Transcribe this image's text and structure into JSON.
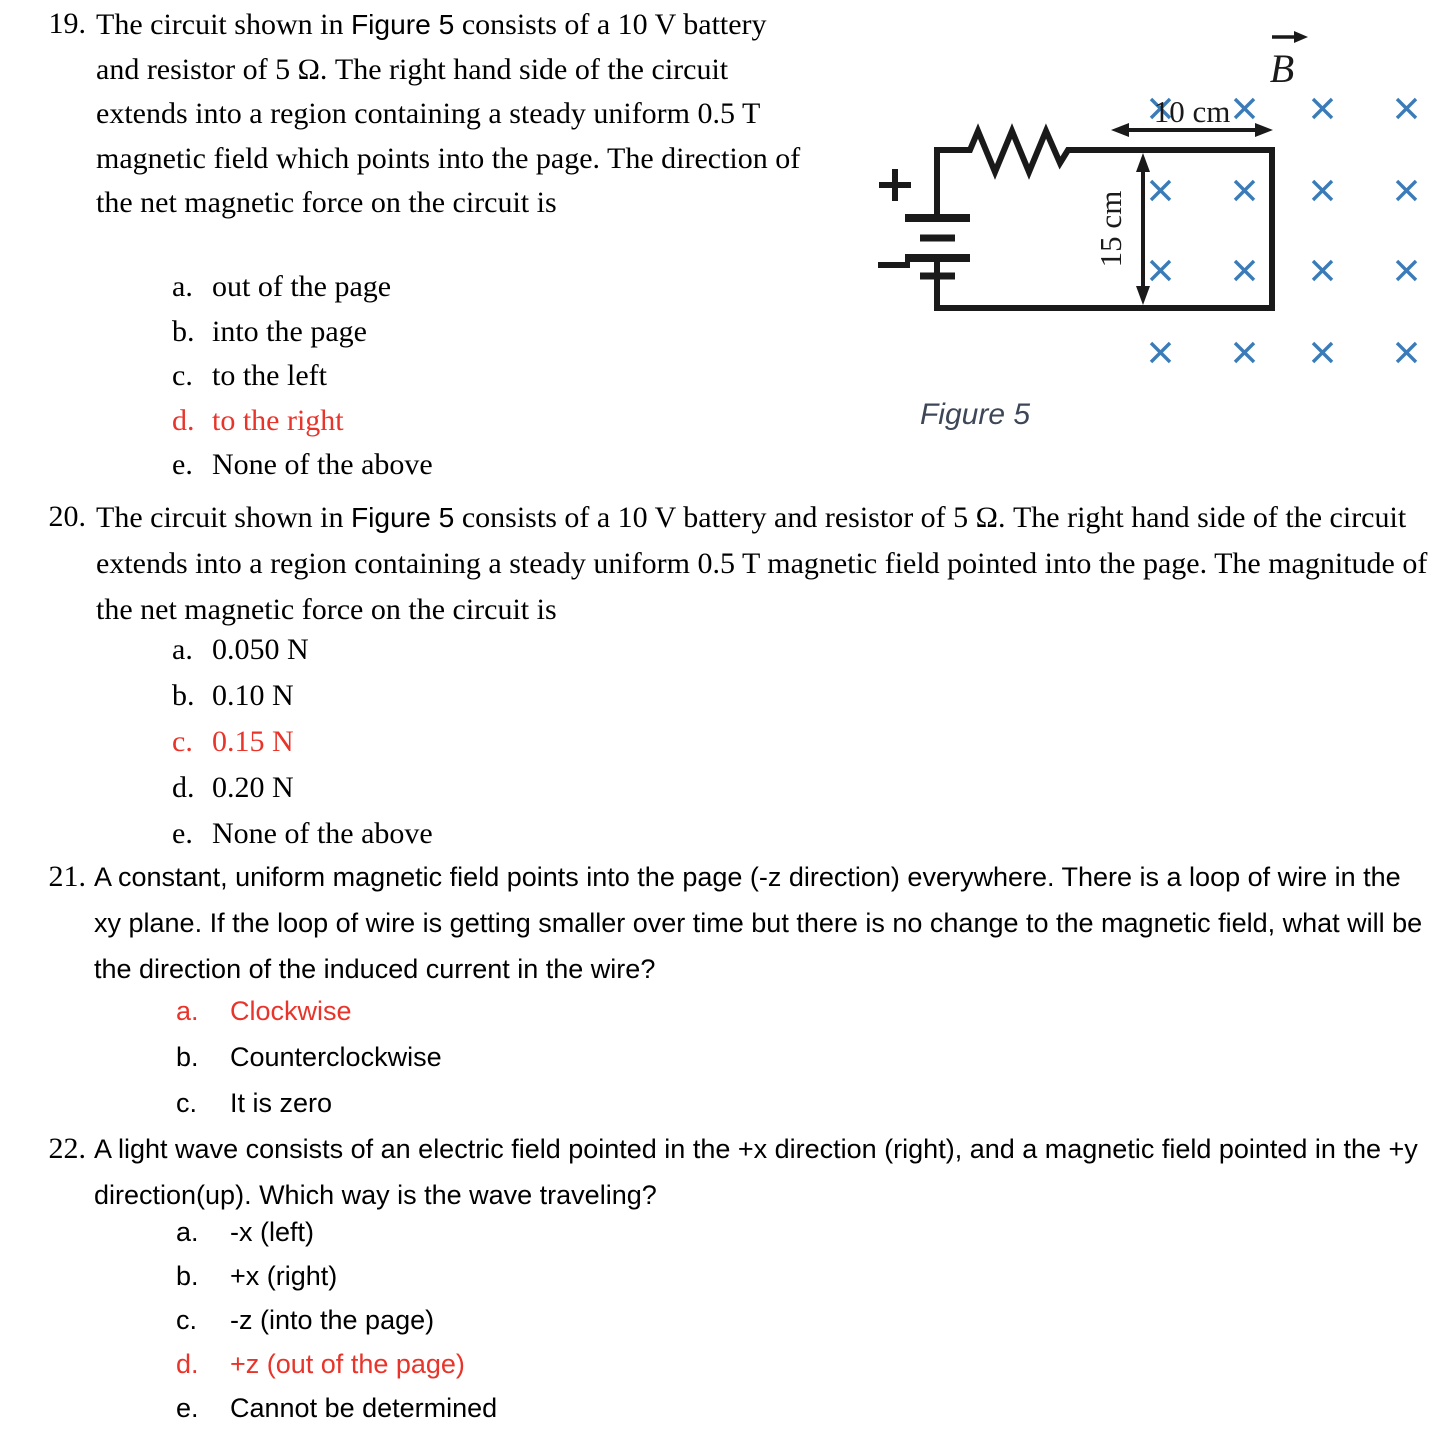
{
  "document": {
    "type": "physics-multiple-choice-worksheet",
    "answer_color": "#e8342a",
    "field_marker_color": "#3b7cb8",
    "caption_color": "#3d4757"
  },
  "questions": [
    {
      "number": "19.",
      "stem_pre": "The circuit shown in ",
      "stem_figref": "Figure 5",
      "stem_post": " consists of a 10 V battery and resistor of 5 Ω. The right hand side of the circuit extends into a region containing a steady uniform 0.5 T magnetic field which points into the page. The direction of the net magnetic force on the circuit is",
      "options": [
        {
          "letter": "a.",
          "text": "out of the page",
          "correct": false
        },
        {
          "letter": "b.",
          "text": "into the page",
          "correct": false
        },
        {
          "letter": "c.",
          "text": "to the left",
          "correct": false
        },
        {
          "letter": "d.",
          "text": "to the right",
          "correct": true
        },
        {
          "letter": "e.",
          "text": "None of the above",
          "correct": false
        }
      ]
    },
    {
      "number": "20.",
      "stem_pre": "The circuit shown in ",
      "stem_figref": "Figure 5",
      "stem_post": " consists of a 10 V battery and resistor of 5 Ω. The right hand side of the circuit extends into a region containing a steady uniform 0.5 T magnetic field pointed into the page. The magnitude of the net magnetic force on the circuit is",
      "options": [
        {
          "letter": "a.",
          "text": "0.050 N",
          "correct": false
        },
        {
          "letter": "b.",
          "text": "0.10 N",
          "correct": false
        },
        {
          "letter": "c.",
          "text": "0.15 N",
          "correct": true
        },
        {
          "letter": "d.",
          "text": "0.20 N",
          "correct": false
        },
        {
          "letter": "e.",
          "text": "None of the above",
          "correct": false
        }
      ]
    },
    {
      "number": "21.",
      "stem_pre": "A constant, uniform magnetic field points into the page (-z direction) everywhere. There is a loop of wire in the xy plane. If the loop of wire is getting smaller over time but there is no change to the magnetic field, what will be the direction of the induced current in the wire?",
      "stem_figref": "",
      "stem_post": "",
      "options": [
        {
          "letter": "a.",
          "text": "Clockwise",
          "correct": true
        },
        {
          "letter": "b.",
          "text": "Counterclockwise",
          "correct": false
        },
        {
          "letter": "c.",
          "text": "It is zero",
          "correct": false
        }
      ]
    },
    {
      "number": "22.",
      "stem_pre": "A light wave consists of an electric field pointed in the +x direction (right), and a magnetic field pointed in the +y direction(up). Which way is the wave traveling?",
      "stem_figref": "",
      "stem_post": "",
      "options": [
        {
          "letter": "a.",
          "text": "-x (left)",
          "correct": false
        },
        {
          "letter": "b.",
          "text": "+x (right)",
          "correct": false
        },
        {
          "letter": "c.",
          "text": "-z (into the page)",
          "correct": false
        },
        {
          "letter": "d.",
          "text": "+z (out of the page)",
          "correct": true
        },
        {
          "letter": "e.",
          "text": "Cannot be determined",
          "correct": false
        }
      ]
    }
  ],
  "figure": {
    "caption": "Figure 5",
    "field_label": "B",
    "battery_plus": "+",
    "battery_minus": "−",
    "width_label": "10 cm",
    "height_label": "15 cm",
    "field_marker": "×",
    "field_marker_rows": 4,
    "field_marker_cols": 4
  }
}
